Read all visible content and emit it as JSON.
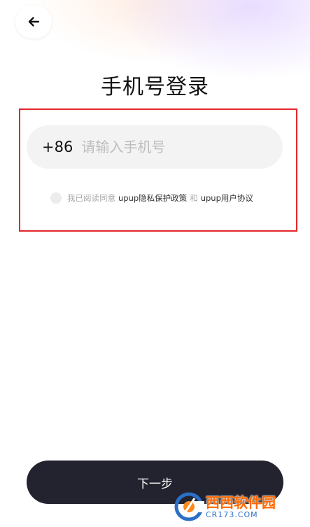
{
  "header": {
    "back_icon": "arrow-left-icon",
    "title": "手机号登录"
  },
  "phone": {
    "country_code": "+86",
    "placeholder": "请输入手机号",
    "value": ""
  },
  "agreement": {
    "prefix": "我已阅读同意",
    "privacy_link": "upup隐私保护政策",
    "conjunction": "和",
    "terms_link": "upup用户协议",
    "checked": false
  },
  "next_button": {
    "label": "下一步",
    "color": "#23232f"
  },
  "watermark": {
    "main": "西西软件园",
    "sub": "CR173.COM"
  },
  "colors": {
    "highlight": "#e3262b",
    "field_bg": "#f3f3f3"
  }
}
